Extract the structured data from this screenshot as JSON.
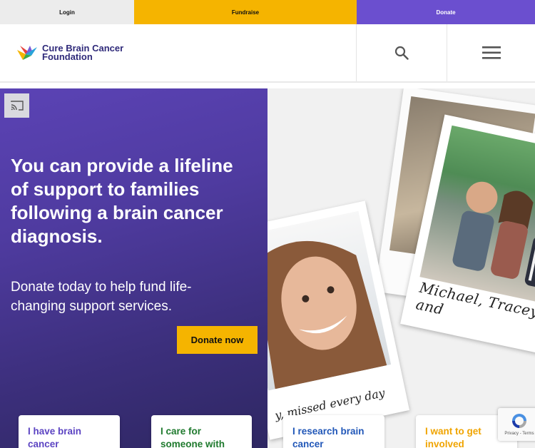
{
  "topbar": {
    "login": "Login",
    "fundraise": "Fundraise",
    "donate": "Donate"
  },
  "header": {
    "logo_line1": "Cure Brain Cancer",
    "logo_line2": "Foundation",
    "search_icon": "search-icon",
    "menu_icon": "hamburger-menu-icon"
  },
  "hero": {
    "title": "You can provide a lifeline of support to families following a brain cancer diagnosis.",
    "subtitle": "Donate today to help fund life-changing support services.",
    "cta": "Donate now",
    "cast_icon": "cast-icon"
  },
  "photos": {
    "family_caption": "Michael, Tracey and",
    "woman_caption": "y, missed every day"
  },
  "cards": [
    {
      "label": "I have brain cancer"
    },
    {
      "label": "I care for someone with"
    },
    {
      "label": "I research brain cancer"
    },
    {
      "label": "I want to get involved"
    }
  ],
  "recaptcha": {
    "links": "Privacy - Terms"
  },
  "colors": {
    "accent_yellow": "#f5b400",
    "accent_purple": "#6b4fcf"
  }
}
